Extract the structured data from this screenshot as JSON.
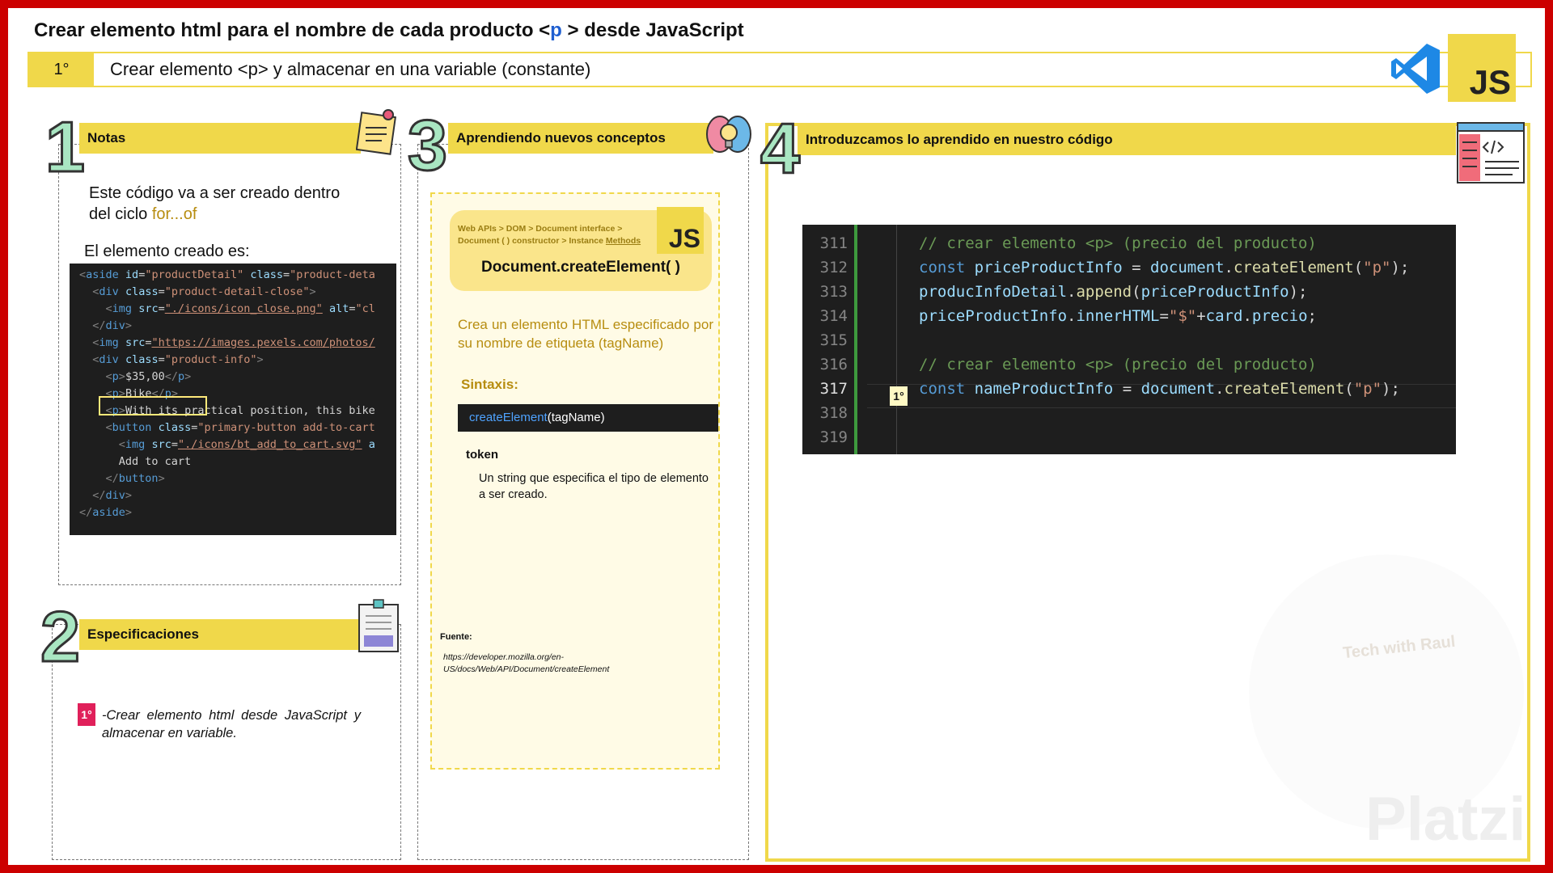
{
  "title_pre": "Crear elemento html para el nombre de cada producto <",
  "title_p": "p",
  "title_post": "> desde JavaScript",
  "step": {
    "num": "1°",
    "text": "Crear elemento <p> y almacenar en una variable (constante)"
  },
  "js_badge": "JS",
  "panels": {
    "notas": {
      "num": "1",
      "header": "Notas",
      "text1_a": "Este código va a ser creado dentro",
      "text1_b": "del ciclo ",
      "for_of": "for...of",
      "text2": "El elemento creado es:"
    },
    "especificaciones": {
      "num": "2",
      "header": "Especificaciones",
      "badge": "1°",
      "text": "-Crear elemento html desde JavaScript y almacenar en variable."
    },
    "aprendiendo": {
      "num": "3",
      "header": "Aprendiendo nuevos conceptos",
      "breadcrumb_a": "Web APIs > DOM > Document interface >",
      "breadcrumb_b": "Document ( ) constructor > Instance ",
      "breadcrumb_methods": "Methods",
      "js": "JS",
      "doc_title": "Document.createElement( )",
      "description": "Crea un elemento HTML especificado por su nombre de etiqueta (tagName)",
      "sintaxis": "Sintaxis:",
      "syntax_fn": "createElement",
      "syntax_arg": "(tagName)",
      "token": "token",
      "token_desc": "Un string que especifica el tipo de elemento a ser creado.",
      "fuente": "Fuente:",
      "fuente_url": "https://developer.mozilla.org/en-US/docs/Web/API/Document/createElement"
    },
    "introduzcamos": {
      "num": "4",
      "header": "Introduzcamos lo aprendido en nuestro código"
    }
  },
  "editor": {
    "lines": [
      "311",
      "312",
      "313",
      "314",
      "315",
      "316",
      "317",
      "318",
      "319"
    ],
    "current_line": "317",
    "marker": "1°"
  },
  "watermark": {
    "brand": "Platzi",
    "tag": "Tech with Raul"
  },
  "colors": {
    "frame": "#cc0000",
    "accent": "#f0d84a",
    "code_bg": "#1e1e1e"
  }
}
